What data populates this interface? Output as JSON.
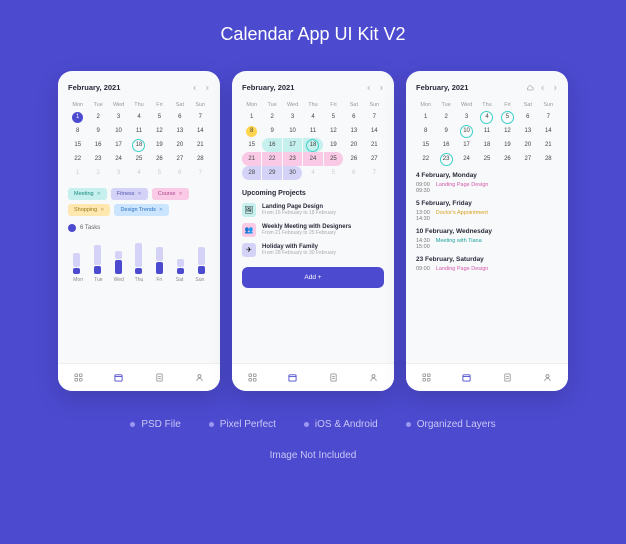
{
  "page_title": "Calendar App UI Kit V2",
  "features": [
    "PSD File",
    "Pixel Perfect",
    "iOS & Android",
    "Organized Layers"
  ],
  "footer_note": "Image Not Included",
  "month_label": "February, 2021",
  "dow": [
    "Mon",
    "Tue",
    "Wed",
    "Thu",
    "Fri",
    "Sat",
    "Sun"
  ],
  "screen1": {
    "calendar": [
      [
        {
          "n": 1,
          "c": "filled"
        },
        {
          "n": 2
        },
        {
          "n": 3
        },
        {
          "n": 4
        },
        {
          "n": 5
        },
        {
          "n": 6
        },
        {
          "n": 7
        }
      ],
      [
        {
          "n": 8
        },
        {
          "n": 9
        },
        {
          "n": 10
        },
        {
          "n": 11
        },
        {
          "n": 12
        },
        {
          "n": 13
        },
        {
          "n": 14
        }
      ],
      [
        {
          "n": 15
        },
        {
          "n": 16
        },
        {
          "n": 17
        },
        {
          "n": 18,
          "c": "ring"
        },
        {
          "n": 19
        },
        {
          "n": 20
        },
        {
          "n": 21
        }
      ],
      [
        {
          "n": 22
        },
        {
          "n": 23
        },
        {
          "n": 24
        },
        {
          "n": 25
        },
        {
          "n": 26
        },
        {
          "n": 27
        },
        {
          "n": 28
        }
      ],
      [
        {
          "n": 1,
          "c": "muted"
        },
        {
          "n": 2,
          "c": "muted"
        },
        {
          "n": 3,
          "c": "muted"
        },
        {
          "n": 4,
          "c": "muted"
        },
        {
          "n": 5,
          "c": "muted"
        },
        {
          "n": 6,
          "c": "muted"
        },
        {
          "n": 7,
          "c": "muted"
        }
      ]
    ],
    "tags": [
      {
        "label": "Meeting",
        "cls": "tg-teal"
      },
      {
        "label": "Fitness",
        "cls": "tg-lav"
      },
      {
        "label": "Course",
        "cls": "tg-pink"
      },
      {
        "label": "Shopping",
        "cls": "tg-yellow"
      },
      {
        "label": "Design Trends",
        "cls": "tg-blue"
      }
    ],
    "tasks_label": "6 Tasks",
    "chart_data": {
      "type": "bar",
      "categories": [
        "Mon",
        "Tue",
        "Wed",
        "Thu",
        "Fri",
        "Sat",
        "Sun"
      ],
      "series": [
        {
          "name": "secondary",
          "values": [
            14,
            20,
            8,
            24,
            14,
            8,
            18
          ]
        },
        {
          "name": "primary",
          "values": [
            6,
            8,
            14,
            6,
            12,
            6,
            8
          ]
        }
      ]
    }
  },
  "screen2": {
    "calendar": [
      [
        {
          "n": 1
        },
        {
          "n": 2
        },
        {
          "n": 3
        },
        {
          "n": 4
        },
        {
          "n": 5
        },
        {
          "n": 6
        },
        {
          "n": 7
        }
      ],
      [
        {
          "n": 8,
          "c": "dot-yellow"
        },
        {
          "n": 9
        },
        {
          "n": 10
        },
        {
          "n": 11
        },
        {
          "n": 12
        },
        {
          "n": 13
        },
        {
          "n": 14
        }
      ],
      [
        {
          "n": 15
        },
        {
          "n": 16,
          "c": "band-teal rl"
        },
        {
          "n": 17,
          "c": "band-teal"
        },
        {
          "n": 18,
          "c": "band-teal rr ring2"
        },
        {
          "n": 19
        },
        {
          "n": 20
        },
        {
          "n": 21
        }
      ],
      [
        {
          "n": 21,
          "c": "band-pink rl"
        },
        {
          "n": 22,
          "c": "band-pink"
        },
        {
          "n": 23,
          "c": "band-pink"
        },
        {
          "n": 24,
          "c": "band-pink"
        },
        {
          "n": 25,
          "c": "band-pink rr"
        },
        {
          "n": 26
        },
        {
          "n": 27
        }
      ],
      [
        {
          "n": 28,
          "c": "band-lav rl"
        },
        {
          "n": 29,
          "c": "band-lav"
        },
        {
          "n": 30,
          "c": "band-lav rr"
        },
        {
          "n": 4,
          "c": "muted"
        },
        {
          "n": 5,
          "c": "muted"
        },
        {
          "n": 6,
          "c": "muted"
        },
        {
          "n": 7,
          "c": "muted"
        }
      ]
    ],
    "section": "Upcoming Projects",
    "projects": [
      {
        "icon": "🖼",
        "cls": "pi-teal",
        "title": "Landing Page Design",
        "sub": "From 16 February to 18 February"
      },
      {
        "icon": "👥",
        "cls": "pi-pink",
        "title": "Weekly Meeting with Designers",
        "sub": "From 21 February to 25 February"
      },
      {
        "icon": "✈",
        "cls": "pi-lav",
        "title": "Holiday with Family",
        "sub": "From 28 February to 30 February"
      }
    ],
    "add_label": "Add  +"
  },
  "screen3": {
    "calendar": [
      [
        {
          "n": 1
        },
        {
          "n": 2
        },
        {
          "n": 3
        },
        {
          "n": 4,
          "c": "ring"
        },
        {
          "n": 5,
          "c": "ring"
        },
        {
          "n": 6
        },
        {
          "n": 7
        }
      ],
      [
        {
          "n": 8
        },
        {
          "n": 9
        },
        {
          "n": 10,
          "c": "ring"
        },
        {
          "n": 11
        },
        {
          "n": 12
        },
        {
          "n": 13
        },
        {
          "n": 14
        }
      ],
      [
        {
          "n": 15
        },
        {
          "n": 16
        },
        {
          "n": 17
        },
        {
          "n": 18
        },
        {
          "n": 19
        },
        {
          "n": 20
        },
        {
          "n": 21
        }
      ],
      [
        {
          "n": 22
        },
        {
          "n": 23,
          "c": "ring2"
        },
        {
          "n": 24
        },
        {
          "n": 25
        },
        {
          "n": 26
        },
        {
          "n": 27
        },
        {
          "n": 28
        }
      ]
    ],
    "schedule": [
      {
        "day": "4 February, Monday",
        "rows": [
          {
            "t1": "09:00",
            "t2": "09:30",
            "ev": "Landing Page Design",
            "cls": "ev-pink"
          }
        ]
      },
      {
        "day": "5 February, Friday",
        "rows": [
          {
            "t1": "13:00",
            "t2": "14:30",
            "ev": "Doctor's Appointment",
            "cls": "ev-yellow"
          }
        ]
      },
      {
        "day": "10 February, Wednesday",
        "rows": [
          {
            "t1": "14:30",
            "t2": "15:00",
            "ev": "Meeting with Tiana",
            "cls": "ev-teal"
          }
        ]
      },
      {
        "day": "23 February, Saturday",
        "rows": [
          {
            "t1": "09:00",
            "t2": "",
            "ev": "Landing Page Design",
            "cls": "ev-pink"
          }
        ]
      }
    ]
  }
}
